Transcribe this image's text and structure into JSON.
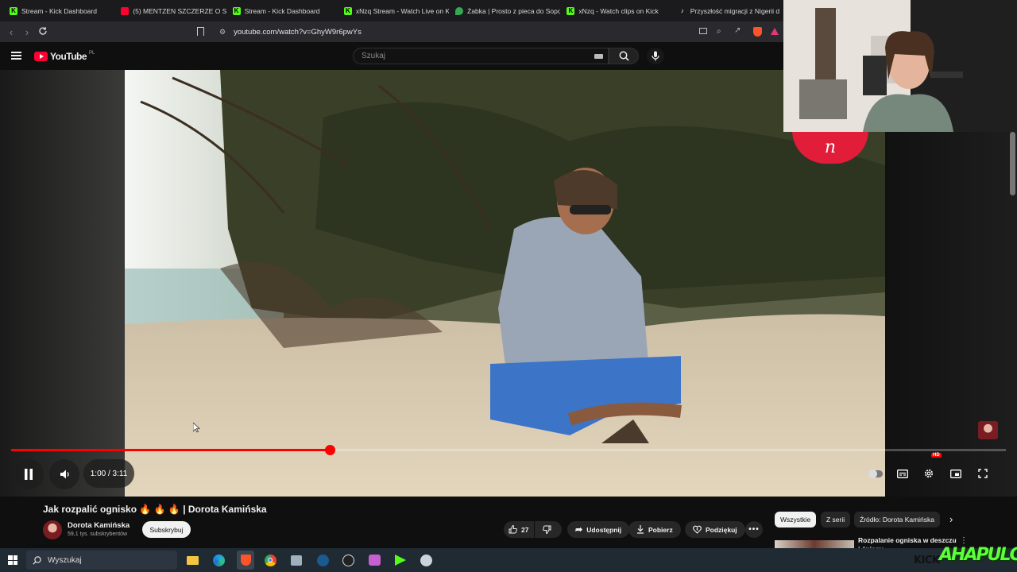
{
  "tabs": [
    {
      "label": "Stream - Kick Dashboard",
      "icon": "kick-icon",
      "color": "#53fc18"
    },
    {
      "label": "(5) MENTZEN SZCZERZE O SW",
      "icon": "youtube-icon",
      "color": "#ff0033"
    },
    {
      "label": "Stream - Kick Dashboard",
      "icon": "kick-icon",
      "color": "#53fc18"
    },
    {
      "label": "xNzq Stream - Watch Live on K",
      "icon": "kick-icon",
      "color": "#53fc18"
    },
    {
      "label": "Żabka | Prosto z pieca do Sopo",
      "icon": "maps-icon",
      "color": "#34a853"
    },
    {
      "label": "xNzq - Watch clips on Kick",
      "icon": "kick-icon",
      "color": "#53fc18"
    },
    {
      "label": "Przyszłość migracji z Nigerii d",
      "icon": "tiktok-icon",
      "color": "#ffffff"
    }
  ],
  "address": {
    "url": "youtube.com/watch?v=GhyW9r6pwYs"
  },
  "youtube": {
    "logo_text": "YouTube",
    "region": "PL",
    "search_placeholder": "Szukaj"
  },
  "player": {
    "time": "1:00 / 3:11",
    "progress": 0.32,
    "quality_badge": "HD",
    "watermark": "n"
  },
  "video_info": {
    "title": "Jak rozpalić ognisko 🔥 🔥 🔥 | Dorota Kamińska",
    "channel": "Dorota Kamińska",
    "subscribers": "59,1 tys. subskrybentów",
    "subscribe_label": "Subskrybuj",
    "likes": "27",
    "share_label": "Udostępnij",
    "download_label": "Pobierz",
    "thanks_label": "Podziękuj"
  },
  "chips": [
    "Wszystkie",
    "Z serii",
    "Źródło: Dorota Kamińska"
  ],
  "recommended": {
    "title": "Rozpalanie ogniska w deszczu i śniegu"
  },
  "taskbar": {
    "search_label": "Wyszukaj"
  },
  "overlay": {
    "kick": "KICK",
    "brand": "AHAPULCO"
  }
}
